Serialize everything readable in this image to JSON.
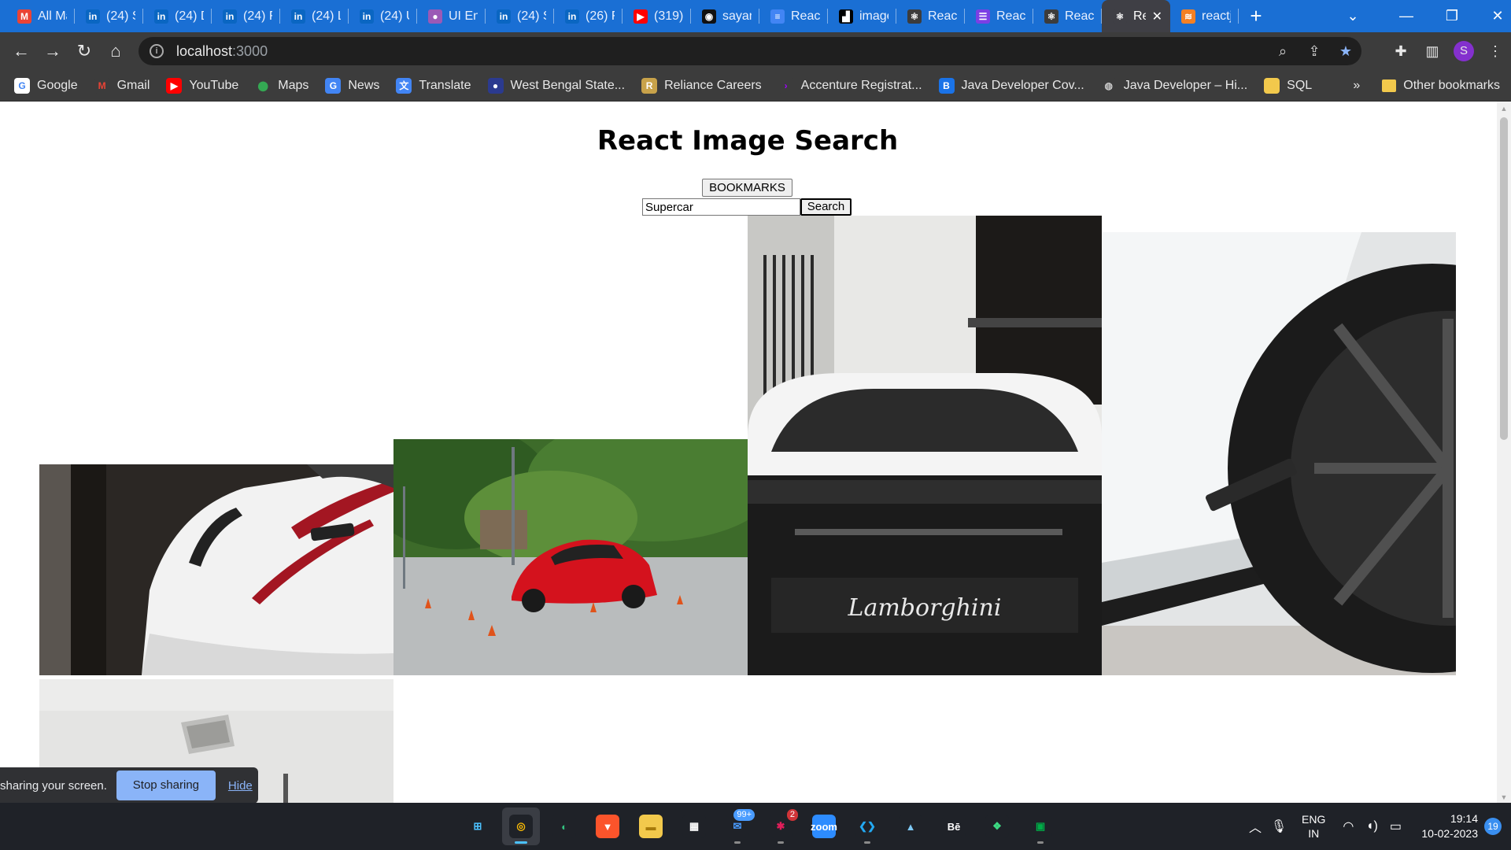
{
  "browser": {
    "tabs": [
      {
        "title": "All Ma",
        "icon": "gmail-icon",
        "color": "#ea4335",
        "glyph": "M"
      },
      {
        "title": "(24) S",
        "icon": "linkedin-icon",
        "color": "#0a66c2",
        "glyph": "in"
      },
      {
        "title": "(24) D",
        "icon": "linkedin-icon",
        "color": "#0a66c2",
        "glyph": "in"
      },
      {
        "title": "(24) F",
        "icon": "linkedin-icon",
        "color": "#0a66c2",
        "glyph": "in"
      },
      {
        "title": "(24) L",
        "icon": "linkedin-icon",
        "color": "#0a66c2",
        "glyph": "in"
      },
      {
        "title": "(24) U",
        "icon": "linkedin-icon",
        "color": "#0a66c2",
        "glyph": "in"
      },
      {
        "title": "UI Eng",
        "icon": "circle-icon",
        "color": "#9b59b6",
        "glyph": "●"
      },
      {
        "title": "(24) S",
        "icon": "linkedin-icon",
        "color": "#0a66c2",
        "glyph": "in"
      },
      {
        "title": "(26) F",
        "icon": "linkedin-icon",
        "color": "#0a66c2",
        "glyph": "in"
      },
      {
        "title": "(319)",
        "icon": "youtube-icon",
        "color": "#ff0000",
        "glyph": "▶"
      },
      {
        "title": "sayan",
        "icon": "github-icon",
        "color": "#111",
        "glyph": "◉"
      },
      {
        "title": "React",
        "icon": "docs-icon",
        "color": "#4285f4",
        "glyph": "≡"
      },
      {
        "title": "image",
        "icon": "unsplash-icon",
        "color": "#000",
        "glyph": "▟"
      },
      {
        "title": "React",
        "icon": "react-icon",
        "color": "#3c3c3c",
        "glyph": "⚛"
      },
      {
        "title": "React",
        "icon": "list-icon",
        "color": "#7b3fe4",
        "glyph": "☰"
      },
      {
        "title": "React",
        "icon": "react-icon",
        "color": "#3c3c3c",
        "glyph": "⚛"
      },
      {
        "title": "Re",
        "icon": "react-icon",
        "color": "#3f3f45",
        "glyph": "⚛",
        "active": true
      },
      {
        "title": "reactj",
        "icon": "stackoverflow-icon",
        "color": "#f48024",
        "glyph": "≋"
      }
    ],
    "address": {
      "host": "localhost",
      "port": ":3000"
    },
    "profile_initial": "S",
    "bookmarks": [
      {
        "label": "Google",
        "icon": "google-icon",
        "color": "#fff",
        "fg": "#4285f4",
        "glyph": "G"
      },
      {
        "label": "Gmail",
        "icon": "gmail-icon",
        "color": "#3c3c3c",
        "fg": "#ea4335",
        "glyph": "M"
      },
      {
        "label": "YouTube",
        "icon": "youtube-icon",
        "color": "#ff0000",
        "fg": "#fff",
        "glyph": "▶"
      },
      {
        "label": "Maps",
        "icon": "maps-icon",
        "color": "#3c3c3c",
        "fg": "#34a853",
        "glyph": "⬤"
      },
      {
        "label": "News",
        "icon": "news-icon",
        "color": "#4285f4",
        "fg": "#fff",
        "glyph": "G"
      },
      {
        "label": "Translate",
        "icon": "translate-icon",
        "color": "#4285f4",
        "fg": "#fff",
        "glyph": "文"
      },
      {
        "label": "West Bengal State...",
        "icon": "wb-state-icon",
        "color": "#2b3a8f",
        "fg": "#fff",
        "glyph": "●"
      },
      {
        "label": "Reliance Careers",
        "icon": "reliance-icon",
        "color": "#c8a24a",
        "fg": "#fff",
        "glyph": "R"
      },
      {
        "label": "Accenture Registrat...",
        "icon": "accenture-icon",
        "color": "#3c3c3c",
        "fg": "#a100ff",
        "glyph": "›"
      },
      {
        "label": "Java Developer Cov...",
        "icon": "java-cover-icon",
        "color": "#1a73e8",
        "fg": "#fff",
        "glyph": "B"
      },
      {
        "label": "Java Developer – Hi...",
        "icon": "globe-icon",
        "color": "#3c3c3c",
        "fg": "#ccc",
        "glyph": "◍"
      },
      {
        "label": "SQL",
        "icon": "folder-icon",
        "color": "#f2c94c",
        "fg": "#f2c94c",
        "glyph": "■"
      }
    ],
    "other_bookmarks": "Other bookmarks"
  },
  "app": {
    "title": "React Image Search",
    "bookmarks_button": "BOOKMARKS",
    "search_value": "Supercar",
    "search_button": "Search",
    "images": [
      {
        "subject": "white-koenigsegg-front"
      },
      {
        "subject": "red-ferrari-cones"
      },
      {
        "subject": "white-lamborghini-rear"
      },
      {
        "subject": "white-huracan-evo-side"
      },
      {
        "subject": "ceiling-vent"
      }
    ]
  },
  "share_bar": {
    "text": "sharing your screen.",
    "stop_button": "Stop sharing",
    "hide_link": "Hide"
  },
  "taskbar": {
    "apps": [
      {
        "name": "windows-start-icon",
        "color": "#1f2228",
        "glyph": "⊞",
        "fg": "#4cc2ff"
      },
      {
        "name": "chrome-icon",
        "color": "#1f2228",
        "glyph": "◎",
        "fg": "#fbbc05",
        "active": true
      },
      {
        "name": "edge-icon",
        "color": "#1f2228",
        "glyph": "◐",
        "fg": "#33c481"
      },
      {
        "name": "brave-icon",
        "color": "#fb542b",
        "glyph": "▼",
        "fg": "#fff"
      },
      {
        "name": "file-explorer-icon",
        "color": "#f2c94c",
        "glyph": "▬",
        "fg": "#a77b0a"
      },
      {
        "name": "store-icon",
        "color": "#1f2228",
        "glyph": "▦",
        "fg": "#fff"
      },
      {
        "name": "mail-icon",
        "color": "#1f2228",
        "glyph": "✉",
        "fg": "#4a9cff",
        "badge": "99+"
      },
      {
        "name": "slack-icon",
        "color": "#1f2228",
        "glyph": "✱",
        "fg": "#e01e5a",
        "badge": "2",
        "badge_red": true
      },
      {
        "name": "zoom-icon",
        "color": "#2d8cff",
        "glyph": "zoom",
        "fg": "#fff"
      },
      {
        "name": "vscode-icon",
        "color": "#1f2228",
        "glyph": "❮❯",
        "fg": "#23a9f2"
      },
      {
        "name": "photos-icon",
        "color": "#1f2228",
        "glyph": "▲",
        "fg": "#7ec8f5"
      },
      {
        "name": "behance-icon",
        "color": "#1f2228",
        "glyph": "Bē",
        "fg": "#fff"
      },
      {
        "name": "widgets-icon",
        "color": "#1f2228",
        "glyph": "❖",
        "fg": "#3ddc84"
      },
      {
        "name": "meet-icon",
        "color": "#1f2228",
        "glyph": "▣",
        "fg": "#00ac47"
      }
    ],
    "lang_top": "ENG",
    "lang_bottom": "IN",
    "time": "19:14",
    "date": "10-02-2023",
    "notifications": "19"
  }
}
